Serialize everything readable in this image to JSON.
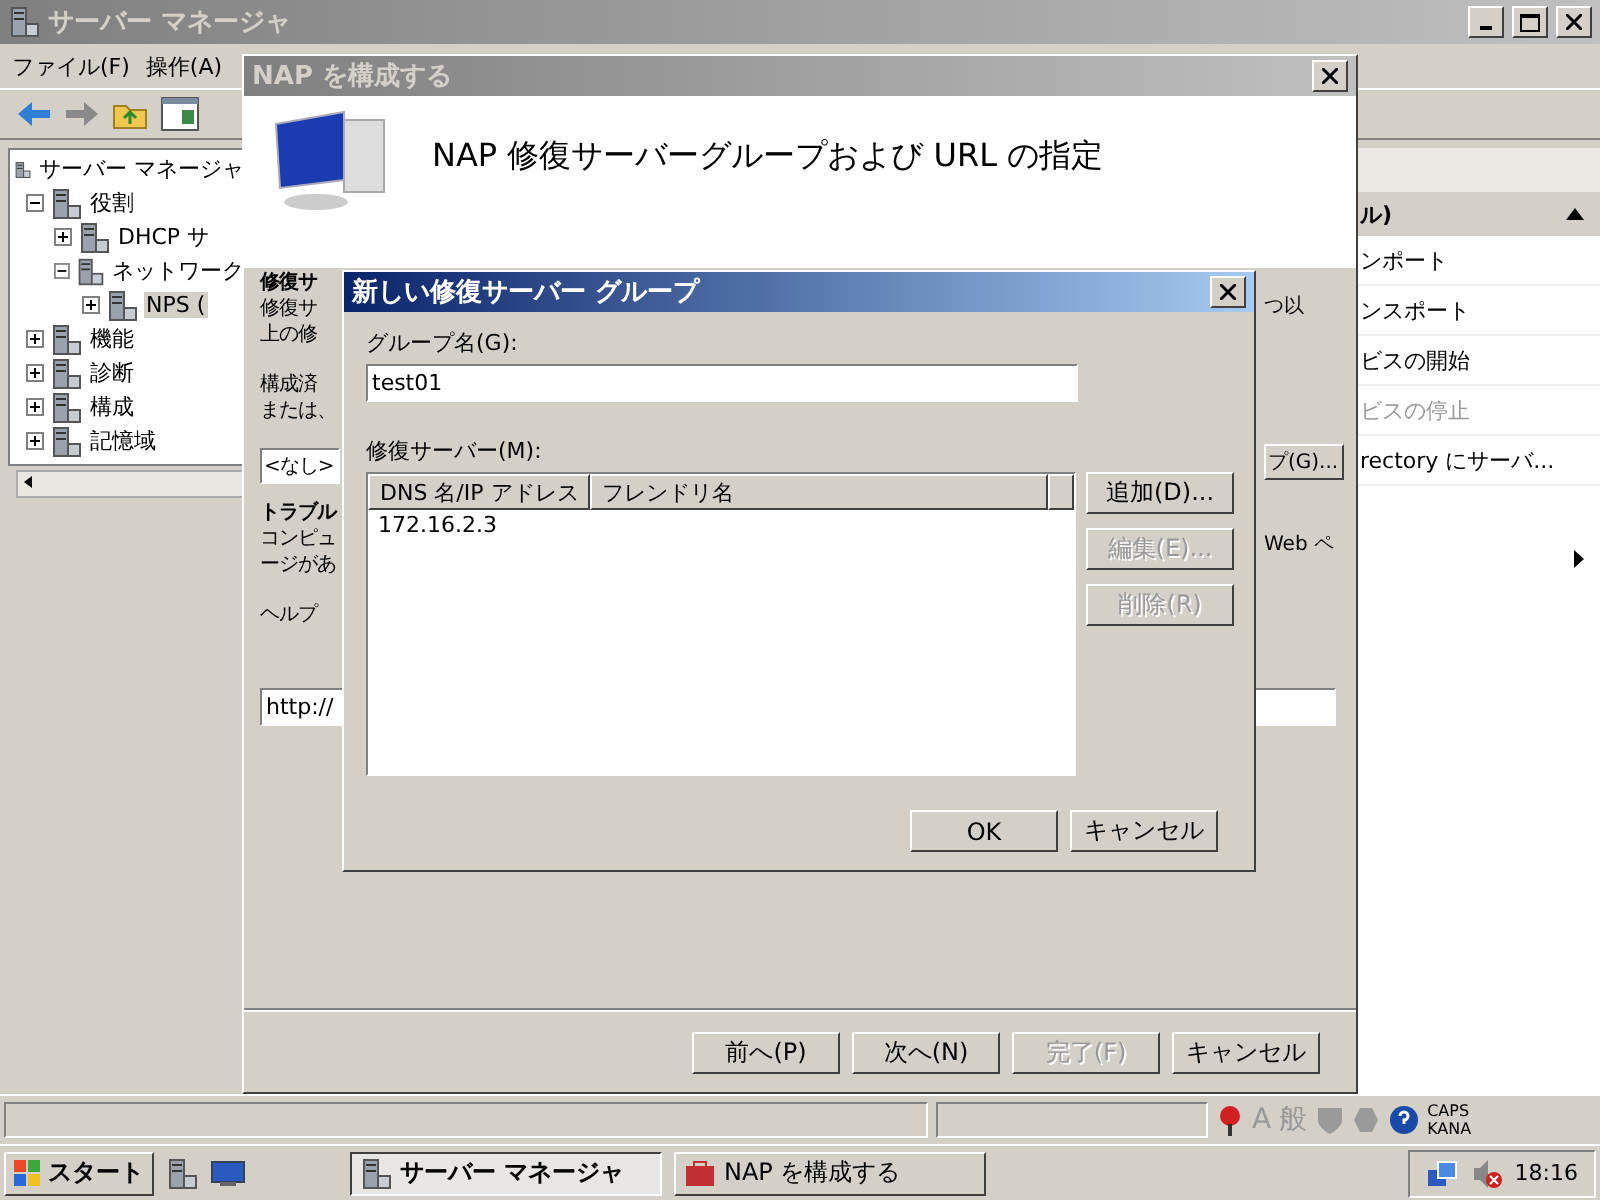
{
  "main_window": {
    "title": "サーバー マネージャ",
    "menu": [
      "ファイル(F)",
      "操作(A)"
    ],
    "tree": {
      "root": "サーバー マネージャ",
      "items": [
        {
          "label": "役割",
          "expanded": true,
          "selected": false,
          "children": [
            {
              "label": "DHCP サ",
              "expanded": false,
              "selected": false
            },
            {
              "label": "ネットワーク",
              "expanded": true,
              "selected": false,
              "children": [
                {
                  "label": "NPS (",
                  "expanded": false,
                  "selected": true
                }
              ]
            }
          ]
        },
        {
          "label": "機能",
          "expanded": false,
          "selected": false
        },
        {
          "label": "診断",
          "expanded": false,
          "selected": false
        },
        {
          "label": "構成",
          "expanded": false,
          "selected": false
        },
        {
          "label": "記憶域",
          "expanded": false,
          "selected": false
        }
      ]
    },
    "actions": {
      "section_title": "ル)",
      "items": [
        {
          "label": "ンポート",
          "disabled": false
        },
        {
          "label": "ンスポート",
          "disabled": false
        },
        {
          "label": "ビスの開始",
          "disabled": false
        },
        {
          "label": "ビスの停止",
          "disabled": true
        },
        {
          "label": "rectory にサーバ...",
          "disabled": false
        }
      ]
    },
    "status_bar": {
      "ime": [
        "A",
        "般"
      ],
      "locks": [
        "CAPS",
        "KANA"
      ]
    }
  },
  "wizard": {
    "title": "NAP を構成する",
    "heading": "NAP 修復サーバーグループおよび URL の指定",
    "left_fragments": [
      {
        "text": "修復サ",
        "kind": "bold"
      },
      {
        "text": "修復サ",
        "kind": "plain"
      },
      {
        "text": "上の修",
        "kind": "plain"
      },
      {
        "text": "構成済",
        "kind": "gap"
      },
      {
        "text": "または、",
        "kind": "plain"
      },
      {
        "text": "<なし>",
        "kind": "select"
      },
      {
        "text": "トラブル",
        "kind": "bold"
      },
      {
        "text": "コンピュ",
        "kind": "plain"
      },
      {
        "text": "ージがあ",
        "kind": "plain"
      },
      {
        "text": "ヘルプ",
        "kind": "gap"
      }
    ],
    "right_fragments": [
      {
        "text": "つ以",
        "kind": "plain"
      },
      {
        "text": "プ(G)...",
        "kind": "button"
      },
      {
        "text": "Web ペ",
        "kind": "plain"
      }
    ],
    "url_field": "http://",
    "buttons": [
      {
        "label": "前へ(P)",
        "disabled": false
      },
      {
        "label": "次へ(N)",
        "disabled": false
      },
      {
        "label": "完了(F)",
        "disabled": true
      },
      {
        "label": "キャンセル",
        "disabled": false
      }
    ]
  },
  "dialog": {
    "title": "新しい修復サーバー グループ",
    "group_label": "グループ名(G):",
    "group_name": "test01",
    "servers_label": "修復サーバー(M):",
    "columns": [
      "DNS 名/IP アドレス",
      "フレンドリ名"
    ],
    "rows": [
      [
        "172.16.2.3",
        ""
      ]
    ],
    "side_buttons": [
      {
        "label": "追加(D)...",
        "disabled": false
      },
      {
        "label": "編集(E)...",
        "disabled": true
      },
      {
        "label": "削除(R)",
        "disabled": true
      }
    ],
    "buttons": [
      "OK",
      "キャンセル"
    ]
  },
  "taskbar": {
    "start": "スタート",
    "tasks": [
      {
        "label": "サーバー マネージャ",
        "selected": true
      },
      {
        "label": "NAP を構成する",
        "selected": false
      }
    ],
    "clock": "18:16"
  }
}
